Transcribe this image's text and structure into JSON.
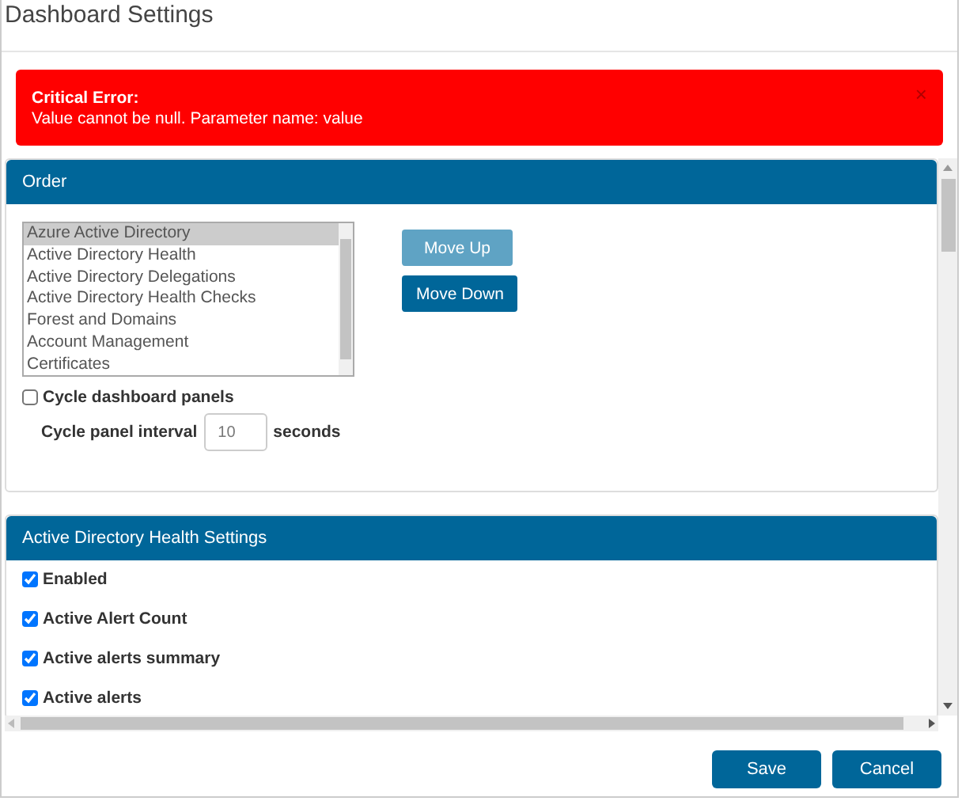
{
  "dialog": {
    "title": "Dashboard Settings"
  },
  "alert": {
    "heading": "Critical Error:",
    "message": "Value cannot be null. Parameter name: value",
    "close": "×"
  },
  "order_panel": {
    "title": "Order",
    "items": [
      {
        "label": "Azure Active Directory",
        "selected": true
      },
      {
        "label": "Active Directory Health",
        "selected": false
      },
      {
        "label": "Active Directory Delegations",
        "selected": false
      },
      {
        "label": "Active Directory Health Checks",
        "selected": false
      },
      {
        "label": "Forest and Domains",
        "selected": false
      },
      {
        "label": "Account Management",
        "selected": false
      },
      {
        "label": "Certificates",
        "selected": false
      }
    ],
    "buttons": [
      {
        "label": "Move Up",
        "disabled": true
      },
      {
        "label": "Move Down",
        "disabled": false
      }
    ],
    "cycle": {
      "label": "Cycle dashboard panels",
      "checked": false
    },
    "interval": {
      "label": "Cycle panel interval",
      "value": "10",
      "unit": "seconds"
    }
  },
  "health_panel": {
    "title": "Active Directory Health Settings",
    "options": [
      {
        "label": "Enabled",
        "checked": true
      },
      {
        "label": "Active Alert Count",
        "checked": true
      },
      {
        "label": "Active alerts summary",
        "checked": true
      },
      {
        "label": "Active alerts",
        "checked": true
      }
    ]
  },
  "footer": {
    "buttons": [
      "Save",
      "Cancel"
    ]
  }
}
